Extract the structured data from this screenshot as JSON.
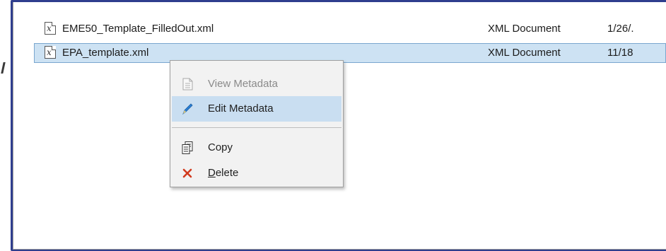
{
  "rows": [
    {
      "icon": "xml-file-icon",
      "name": "EME50_Template_FilledOut.xml",
      "type": "XML Document",
      "date": "1/26/."
    },
    {
      "icon": "xml-file-icon",
      "name": "EPA_template.xml",
      "type": "XML Document",
      "date": "11/18",
      "selected": true
    }
  ],
  "context_menu": {
    "items": [
      {
        "label": "View Metadata",
        "icon": "document-icon",
        "enabled": false
      },
      {
        "label": "Edit Metadata",
        "icon": "pencil-icon",
        "enabled": true,
        "hovered": true
      },
      {
        "label": "Copy",
        "icon": "copy-icon",
        "enabled": true
      },
      {
        "label_mnemonic": "D",
        "label_rest": "elete",
        "icon": "delete-x-icon",
        "enabled": true
      }
    ]
  },
  "colors": {
    "frame_border": "#2f3e8e",
    "selection_bg": "#cde2f3",
    "menu_hover_bg": "#c9def1",
    "delete_icon": "#d13a1e",
    "edit_icon": "#2a7fd4"
  }
}
